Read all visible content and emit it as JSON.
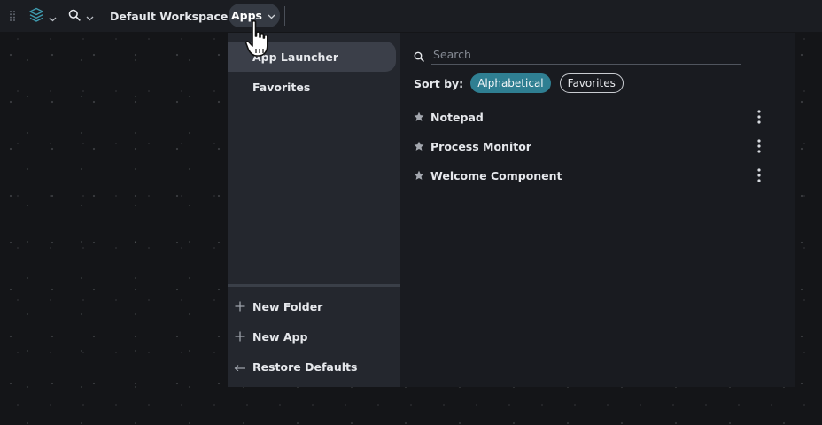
{
  "topbar": {
    "workspace_label": "Default Workspace",
    "apps_label": "Apps"
  },
  "sidebar": {
    "items": [
      {
        "label": "App Launcher",
        "active": true
      },
      {
        "label": "Favorites",
        "active": false
      }
    ],
    "actions": [
      {
        "label": "New Folder",
        "icon": "plus-icon"
      },
      {
        "label": "New App",
        "icon": "plus-icon"
      },
      {
        "label": "Restore Defaults",
        "icon": "undo-arrow-icon"
      }
    ]
  },
  "launcher": {
    "search_placeholder": "Search",
    "sort_label": "Sort by:",
    "sort_options": [
      {
        "label": "Alphabetical",
        "selected": true
      },
      {
        "label": "Favorites",
        "selected": false
      }
    ],
    "apps": [
      {
        "name": "Notepad"
      },
      {
        "name": "Process Monitor"
      },
      {
        "name": "Welcome Component"
      }
    ]
  },
  "colors": {
    "accent": "#2f7f92",
    "panel": "#1a1c21",
    "sidebar": "#24272e",
    "topbar": "#1b1d22"
  }
}
